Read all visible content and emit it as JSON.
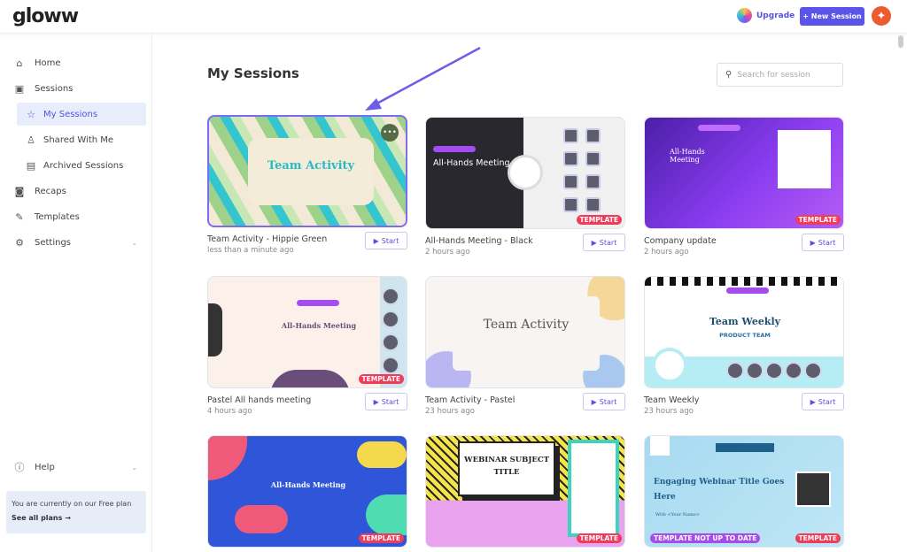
{
  "header": {
    "logo": "gloww",
    "upgrade": "Upgrade",
    "new_session": "+ New Session"
  },
  "sidebar": {
    "items": [
      {
        "label": "Home",
        "icon": "home-icon"
      },
      {
        "label": "Sessions",
        "icon": "sessions-icon"
      },
      {
        "label": "My Sessions",
        "icon": "star-icon",
        "active": true
      },
      {
        "label": "Shared With Me",
        "icon": "shared-icon"
      },
      {
        "label": "Archived Sessions",
        "icon": "archive-icon"
      },
      {
        "label": "Recaps",
        "icon": "recaps-icon"
      },
      {
        "label": "Templates",
        "icon": "templates-icon"
      },
      {
        "label": "Settings",
        "icon": "gear-icon"
      }
    ],
    "help": "Help",
    "plan": {
      "text": "You are currently on our Free plan",
      "link": "See all plans"
    }
  },
  "main": {
    "title": "My Sessions",
    "search_placeholder": "Search for session",
    "start_label": "Start",
    "template_badge": "TEMPLATE",
    "outdated_badge": "TEMPLATE NOT UP TO DATE",
    "cards": [
      {
        "title": "Team Activity - Hippie Green",
        "time": "less than a minute ago",
        "thumb_title": "Team Activity",
        "template": false
      },
      {
        "title": "All-Hands Meeting - Black",
        "time": "2 hours ago",
        "thumb_title": "All-Hands Meeting",
        "template": true
      },
      {
        "title": "Company update",
        "time": "2 hours ago",
        "thumb_title": "All-Hands Meeting",
        "template": true
      },
      {
        "title": "Pastel All hands meeting",
        "time": "4 hours ago",
        "thumb_title": "All-Hands Meeting",
        "template": true
      },
      {
        "title": "Team Activity - Pastel",
        "time": "23 hours ago",
        "thumb_title": "Team Activity",
        "template": false
      },
      {
        "title": "Team Weekly",
        "time": "23 hours ago",
        "thumb_title": "Team Weekly",
        "thumb_sub": "PRODUCT TEAM",
        "template": false
      },
      {
        "thumb_title": "All-Hands Meeting",
        "template": true
      },
      {
        "thumb_title": "WEBINAR SUBJECT TITLE",
        "template": true
      },
      {
        "thumb_title": "Engaging Webinar Title Goes Here",
        "thumb_sub": "With <Your Name>",
        "template": true,
        "outdated": true
      }
    ]
  },
  "colors": {
    "accent": "#5b54e8",
    "template": "#ee3c5a",
    "selected_border": "#7b6cf0"
  }
}
